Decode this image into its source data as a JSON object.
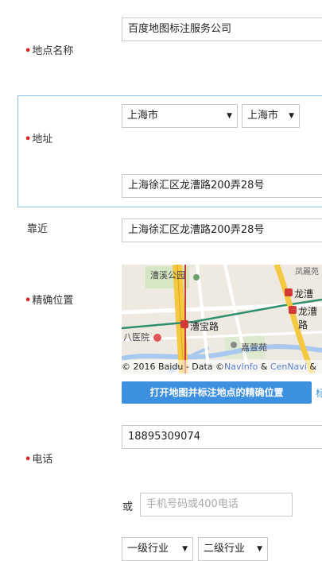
{
  "form": {
    "place_name": {
      "label": "地点名称",
      "value": "百度地图标注服务公司"
    },
    "address": {
      "label": "地址",
      "province": "上海市",
      "city": "上海市",
      "detail": "上海徐汇区龙漕路200弄28号"
    },
    "nearby": {
      "label": "靠近",
      "value": "上海徐汇区龙漕路200弄28号"
    },
    "location": {
      "label": "精确位置",
      "button_label": "打开地图并标注地点的精确位置",
      "button_extra": "标",
      "map": {
        "labels": {
          "park": "漕溪公园",
          "station_a": "漕宝路",
          "hospital": "八医院",
          "garden": "嘉萱苑",
          "station_b": "龙漕",
          "station_b2": "龙漕路",
          "corner": "凤麗苑"
        },
        "attribution_prefix": "© 2016 Baidu - Data ©",
        "attribution_link1": "NavInfo",
        "attribution_amp": "&",
        "attribution_link2": "CenNavi",
        "attribution_suffix": "&"
      }
    },
    "phone": {
      "label": "电话",
      "value": "18895309074",
      "or_label": "或",
      "alt_placeholder": "手机号码或400电话"
    },
    "industry": {
      "level1": "一级行业",
      "level2": "二级行业"
    },
    "required_mark": "•",
    "arrow": "▼"
  },
  "colors": {
    "accent": "#3d8fe0",
    "required": "#e02020",
    "focus_border": "#8ec1e8"
  }
}
